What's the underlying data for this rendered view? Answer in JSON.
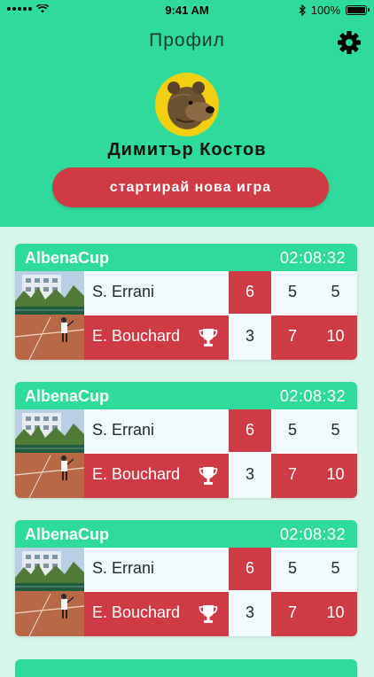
{
  "status_bar": {
    "time": "9:41 AM",
    "battery": "100%",
    "icons": [
      "signal-icon",
      "wifi-icon",
      "bluetooth-icon",
      "battery-icon"
    ]
  },
  "header": {
    "title": "Профил",
    "settings_icon": "gear-icon",
    "user_name": "Димитър Костов",
    "avatar": "bear-avatar",
    "start_button": "стартирай нова игра"
  },
  "colors": {
    "accent_green": "#2fdb9a",
    "accent_red": "#cf3b45",
    "background": "#d8f5ea"
  },
  "matches": [
    {
      "tournament": "AlbenaCup",
      "duration": "02:08:32",
      "player1": {
        "name": "S. Errani",
        "sets": [
          "6",
          "5",
          "5"
        ]
      },
      "player2": {
        "name": "E. Bouchard",
        "sets": [
          "3",
          "7",
          "10"
        ],
        "winner_icon": "trophy-icon"
      }
    },
    {
      "tournament": "AlbenaCup",
      "duration": "02:08:32",
      "player1": {
        "name": "S. Errani",
        "sets": [
          "6",
          "5",
          "5"
        ]
      },
      "player2": {
        "name": "E. Bouchard",
        "sets": [
          "3",
          "7",
          "10"
        ],
        "winner_icon": "trophy-icon"
      }
    },
    {
      "tournament": "AlbenaCup",
      "duration": "02:08:32",
      "player1": {
        "name": "S. Errani",
        "sets": [
          "6",
          "5",
          "5"
        ]
      },
      "player2": {
        "name": "E. Bouchard",
        "sets": [
          "3",
          "7",
          "10"
        ],
        "winner_icon": "trophy-icon"
      }
    }
  ]
}
